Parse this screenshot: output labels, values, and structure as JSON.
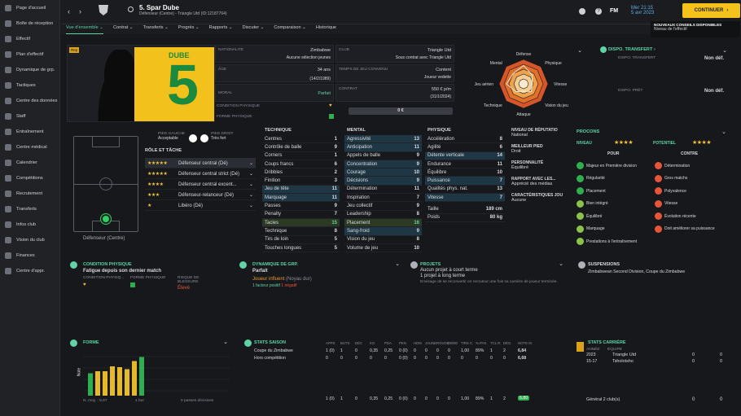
{
  "sidebar": {
    "items": [
      "Page d'accueil",
      "Boîte de réception",
      "Effectif",
      "Plan d'effectif",
      "Dynamique de grp.",
      "Tactiques",
      "Centre des données",
      "Staff",
      "Entraînement",
      "Centre médical",
      "Calendrier",
      "Compétitions",
      "Recrutement",
      "Transferts",
      "Infos club",
      "Vision du club",
      "Finances",
      "Centre d'appr."
    ]
  },
  "header": {
    "player_name": "5. Spar Dube",
    "player_sub": "Défenseur (Centre) - Triangle Utd (ID:12187764)",
    "date_time": "Mer 21:15",
    "date": "5 avr 2023",
    "continue_label": "CONTINUER",
    "fm": "FM",
    "notif_title": "NOUVEAUX CONSEILS DISPONIBLES",
    "notif_sub": "Niveau de l'effectif"
  },
  "tabs": [
    "Vue d'ensemble",
    "Contrat",
    "Transferts",
    "Progrès",
    "Rapports",
    "Discuter",
    "Comparaison",
    "Historique"
  ],
  "profile": {
    "shirt_name": "DUBE",
    "shirt_number": "5",
    "rep_badge": "Rep",
    "nationality_label": "NATIONALITÉ",
    "nationality": "Zimbabwe",
    "selections": "Aucune sélection jeunes",
    "club_label": "CLUB",
    "club": "Triangle Utd",
    "club_contract": "Sous contrat avec Triangle Utd",
    "age_label": "ÂGE",
    "age": "34 ans",
    "birth": "(14/2/1989)",
    "playtime_label": "TEMPS DE JEU CONVENU",
    "playtime": "Content",
    "role": "Joueur vedette",
    "moral_label": "MORAL",
    "moral": "Parfait",
    "contract_label": "CONTRAT",
    "wage": "550 € p/m",
    "contract_end": "(31/1/2024)",
    "condition_label": "CONDITION PHYSIQUE",
    "form_label": "FORME PHYSIQUE",
    "value": "0 €"
  },
  "radar": {
    "labels": [
      "Défense",
      "Physique",
      "Vitesse",
      "Vision du jeu",
      "Attaque",
      "Technique",
      "Jeu aérien",
      "Mental"
    ]
  },
  "transfer": {
    "title": "DISPO. TRANSFERT",
    "t_label": "DISPO. TRANSFERT",
    "t_val": "Non déf.",
    "p_label": "DISPO. PRÊT",
    "p_val": "Non déf."
  },
  "positions": {
    "left_foot_label": "PIED GAUCHE",
    "left_foot": "Acceptable",
    "right_foot_label": "PIED DROIT",
    "right_foot": "Très fort",
    "role_title": "RÔLE ET TÂCHE",
    "pitch_label": "Défenseur (Centre)",
    "roles": [
      {
        "stars": "★★★★★",
        "name": "Défenseur central (Dé)"
      },
      {
        "stars": "★★★★★",
        "name": "Défenseur central strict (Dé)"
      },
      {
        "stars": "★★★★",
        "name": "Défenseur central excent..."
      },
      {
        "stars": "★★★",
        "name": "Défenseur-relanceur (Dé)"
      },
      {
        "stars": "★",
        "name": "Libéro (Dé)"
      }
    ]
  },
  "technique": {
    "title": "TECHNIQUE",
    "rows": [
      [
        "Centres",
        "1"
      ],
      [
        "Contrôle de balle",
        "9"
      ],
      [
        "Corners",
        "1"
      ],
      [
        "Coups francs",
        "6"
      ],
      [
        "Dribbles",
        "2"
      ],
      [
        "Finition",
        "3"
      ],
      [
        "Jeu de tête",
        "11"
      ],
      [
        "Marquage",
        "11"
      ],
      [
        "Passes",
        "9"
      ],
      [
        "Penalty",
        "7"
      ],
      [
        "Tacles",
        "15"
      ],
      [
        "Technique",
        "8"
      ],
      [
        "Tirs de loin",
        "5"
      ],
      [
        "Touches longues",
        "5"
      ]
    ]
  },
  "mental": {
    "title": "MENTAL",
    "rows": [
      [
        "Agressivité",
        "13"
      ],
      [
        "Anticipation",
        "11"
      ],
      [
        "Appels de balle",
        "9"
      ],
      [
        "Concentration",
        "9"
      ],
      [
        "Courage",
        "10"
      ],
      [
        "Décisions",
        "9"
      ],
      [
        "Détermination",
        "11"
      ],
      [
        "Inspiration",
        "7"
      ],
      [
        "Jeu collectif",
        "9"
      ],
      [
        "Leadership",
        "8"
      ],
      [
        "Placement",
        "16"
      ],
      [
        "Sang-froid",
        "9"
      ],
      [
        "Vision du jeu",
        "8"
      ],
      [
        "Volume de jeu",
        "10"
      ]
    ]
  },
  "physique": {
    "title": "PHYSIQUE",
    "rows": [
      [
        "Accélération",
        "8"
      ],
      [
        "Agilité",
        "6"
      ],
      [
        "Détente verticale",
        "14"
      ],
      [
        "Endurance",
        "11"
      ],
      [
        "Équilibre",
        "10"
      ],
      [
        "Puissance",
        "7"
      ],
      [
        "Qualités phys. nat.",
        "13"
      ],
      [
        "Vitesse",
        "7"
      ]
    ],
    "height_label": "Taille",
    "height": "189 cm",
    "weight_label": "Poids",
    "weight": "80 kg"
  },
  "info": {
    "rep_label": "NIVEAU DE RÉPUTATIO",
    "rep": "National",
    "foot_label": "MEILLEUR PIED",
    "foot": "Droit",
    "pers_label": "PERSONNALITÉ",
    "pers": "Équilibré",
    "media_label": "RAPPORT AVEC LES...",
    "media": "Apprécié des médias",
    "char_label": "CARACTÉRISTIQUES JOU",
    "char": "Aucune"
  },
  "procons": {
    "title": "PROCONS",
    "level_label": "NIVEAU",
    "potential_label": "POTENTIEL",
    "level_stars": "★★★★",
    "pot_stars": "★★★★",
    "pour": "POUR",
    "contre": "CONTRE",
    "pros": [
      "Majeur en Première division",
      "Régularité",
      "Placement",
      "Bien intégré",
      "Équilibré",
      "Marquage",
      "Prestations à l'entraînement"
    ],
    "cons": [
      "Détermination",
      "Gros matchs",
      "Polyvalence",
      "Vitesse",
      "Évolution récente",
      "Doit améliorer sa puissance"
    ]
  },
  "condition": {
    "title": "CONDITION PHYSIQUE",
    "text": "Fatigue depuis son dernier match",
    "c_label": "CONDITION PHYSIQ...",
    "f_label": "FORME PHYSIQUE",
    "risk_label": "RISQUE DE BLESSURE",
    "risk": "Élevé"
  },
  "dynamics": {
    "title": "DYNAMIQUE DE GRP.",
    "val": "Parfait",
    "influence": "Joueur influent",
    "influence_sub": "(Noyau dur)",
    "pos": "1 facteur positif",
    "neg": "1 négatif"
  },
  "projects": {
    "title": "PROJETS",
    "short": "Aucun projet à court terme",
    "long": "1 projet à long terme",
    "desc": "Envisage de se reconvertir en recruteur une fois sa carrière de joueur terminée."
  },
  "suspensions": {
    "title": "SUSPENSIONS",
    "text": "Zimbabwean Second Division, Coupe du Zimbabwe"
  },
  "forme": {
    "title": "FORME",
    "ylabel": "Note",
    "avg": "N. moy. : 6,97",
    "buts": "1 but",
    "passes": "0 passes décisives"
  },
  "chart_data": {
    "type": "bar",
    "series": [
      {
        "values": [
          1,
          2,
          3,
          4,
          5,
          6,
          7,
          8
        ]
      }
    ]
  },
  "season": {
    "title": "STATS SAISON",
    "cols": [
      "APPS",
      "BUTS",
      "DÉC",
      "KG",
      "PDA",
      "PEN",
      "HDM",
      "JAUNE",
      "ROUGE",
      "DB/90",
      "TIRS C.",
      "%.PAS.",
      "TCL R.",
      "DÉG.",
      "NOTE M."
    ],
    "rows": [
      {
        "name": "Coupe du Zimbabwe",
        "vals": [
          "1 (0)",
          "1",
          "0",
          "0,35",
          "0,25",
          "0 (0)",
          "0",
          "0",
          "0",
          "0",
          "1,00",
          "89%",
          "1",
          "2"
        ],
        "note": "6,84"
      },
      {
        "name": "Hors compétition",
        "vals": [
          "0",
          "0",
          "0",
          "0",
          "0",
          "0 (0)",
          "0",
          "0",
          "0",
          "0",
          "0",
          "0",
          "0",
          "0"
        ],
        "note": "6,68"
      }
    ],
    "total": {
      "vals": [
        "1 (0)",
        "1",
        "0",
        "0,35",
        "0,25",
        "0 (0)",
        "0",
        "0",
        "0",
        "0",
        "1,00",
        "89%",
        "1",
        "2"
      ],
      "note": "6,80"
    }
  },
  "career": {
    "title": "STATS CARRIÈRE",
    "year_h": "ANNÉE",
    "team_h": "ÉQUIPE",
    "rows": [
      [
        "2023",
        "Triangle Utd",
        "0",
        "0"
      ],
      [
        "15-17",
        "Tsholotsho",
        "0",
        "0"
      ]
    ],
    "total": "Général 2 club(s)",
    "tot_a": "0",
    "tot_b": "0"
  }
}
